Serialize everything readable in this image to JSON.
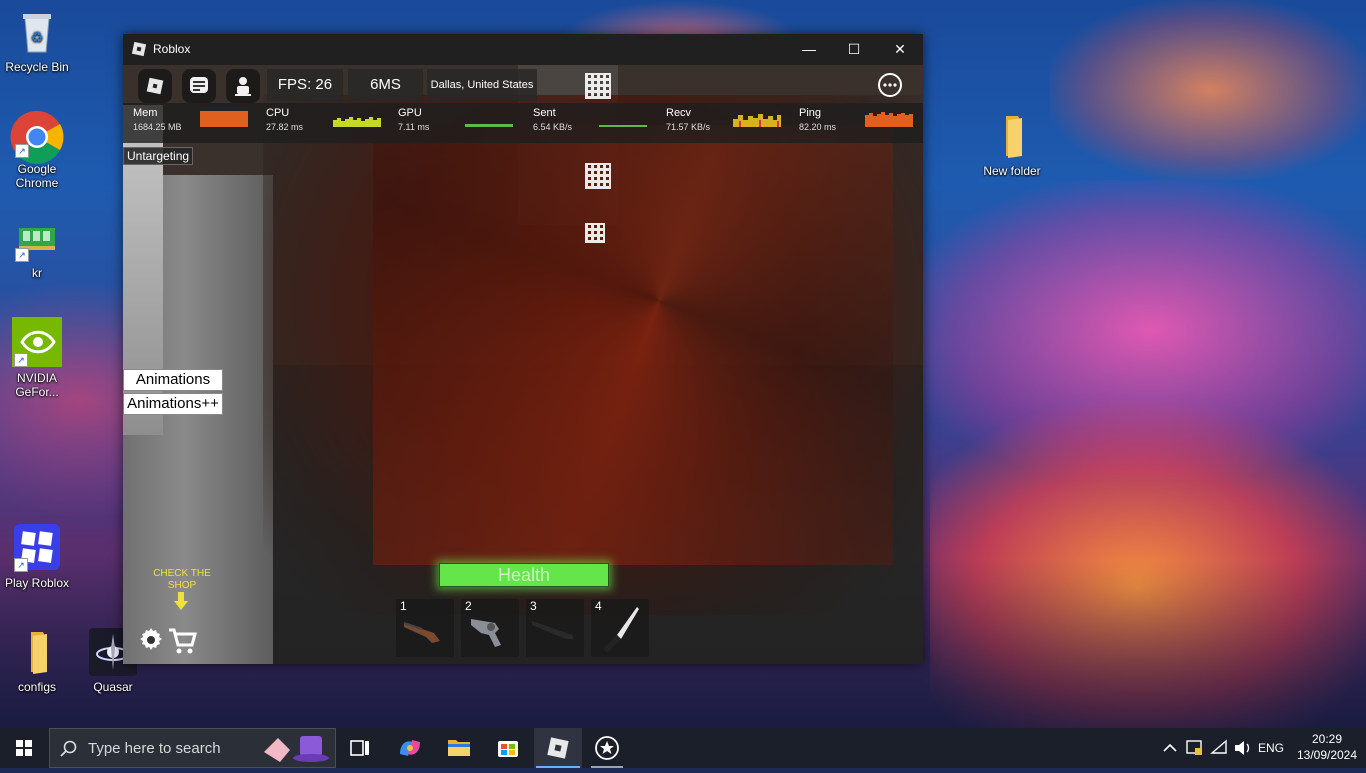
{
  "desktop": {
    "icons": [
      {
        "label": "Recycle Bin"
      },
      {
        "label": "Google Chrome"
      },
      {
        "label": "kr"
      },
      {
        "label": "NVIDIA GeFor..."
      },
      {
        "label": "Play Roblox"
      },
      {
        "label": "configs"
      },
      {
        "label": "Quasar"
      },
      {
        "label": "New folder"
      }
    ]
  },
  "window": {
    "title": "Roblox",
    "controls": {
      "minimize": "—",
      "maximize": "☐",
      "close": "✕"
    }
  },
  "game": {
    "topbar": {
      "fps": "FPS: 26",
      "latency": "6MS",
      "server_location": "Dallas, United States"
    },
    "stats": [
      {
        "label": "Mem",
        "value": "1684.25 MB",
        "color": "#e06020",
        "kind": "bar"
      },
      {
        "label": "CPU",
        "value": "27.82 ms",
        "color": "#c8d82a",
        "kind": "spark"
      },
      {
        "label": "GPU",
        "value": "7.11 ms",
        "color": "#5fb84a",
        "kind": "flat"
      },
      {
        "label": "Sent",
        "value": "6.54 KB/s",
        "color": "#5fb84a",
        "kind": "flat"
      },
      {
        "label": "Recv",
        "value": "71.57 KB/s",
        "color": "#d8b020",
        "kind": "spark"
      },
      {
        "label": "Ping",
        "value": "82.20 ms",
        "color": "#e06020",
        "kind": "bar"
      }
    ],
    "untargeting": "Untargeting",
    "buttons": {
      "animations": "Animations",
      "animations_pp": "Animations++"
    },
    "health_label": "Health",
    "shop_note": "CHECK THE SHOP",
    "hotbar": [
      {
        "slot": "1",
        "item": "shotgun-icon"
      },
      {
        "slot": "2",
        "item": "revolver-icon"
      },
      {
        "slot": "3",
        "item": "rifle-icon"
      },
      {
        "slot": "4",
        "item": "knife-icon"
      }
    ]
  },
  "taskbar": {
    "search_placeholder": "Type here to search",
    "language": "ENG",
    "time": "20:29",
    "date": "13/09/2024"
  }
}
